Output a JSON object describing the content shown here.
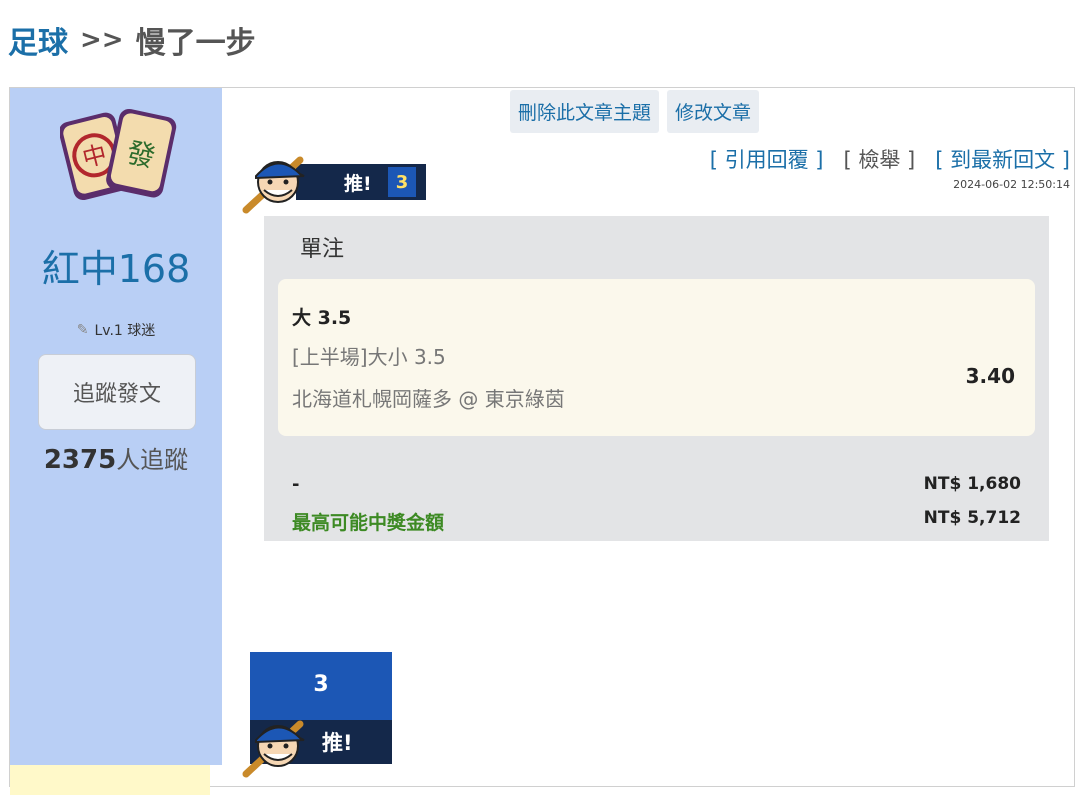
{
  "breadcrumb": {
    "section": "足球",
    "separator": ">>",
    "title": "慢了一步"
  },
  "author": {
    "name": "紅中168",
    "level": "Lv.1 球迷",
    "follow_button": "追蹤發文",
    "follower_count": "2375",
    "follower_suffix": "人追蹤"
  },
  "admin": {
    "delete_label": "刪除此文章主題",
    "edit_label": "修改文章"
  },
  "push": {
    "label": "推!",
    "count": "3"
  },
  "actions": {
    "quote": "[ 引用回覆 ]",
    "report": "[ 檢舉 ]",
    "latest": "[ 到最新回文 ]"
  },
  "timestamp": "2024-06-02 12:50:14",
  "bet": {
    "type": "單注",
    "pick": "大 3.5",
    "market": "[上半場]大小 3.5",
    "match": "北海道札幌岡薩多 @ 東京綠茵",
    "odds": "3.40",
    "stake_label": "-",
    "stake": "NT$ 1,680",
    "payout_label": "最高可能中獎金額",
    "payout": "NT$ 5,712"
  },
  "colors": {
    "sidebar_bg": "#b9cff5",
    "link": "#1b6fa8",
    "push_dark": "#14284a",
    "push_blue": "#1c57b5",
    "payout_green": "#3d8a24"
  },
  "icons": [
    "mahjong-avatar-icon",
    "pencil-icon",
    "baseball-mascot-icon"
  ]
}
